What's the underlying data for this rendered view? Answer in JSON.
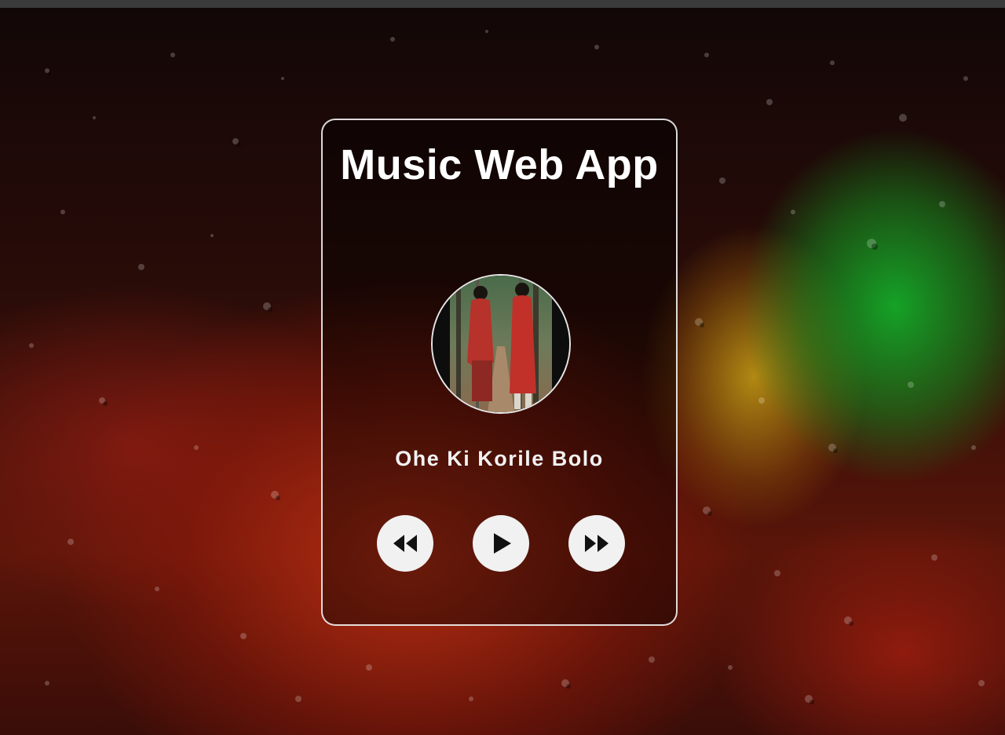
{
  "app": {
    "title": "Music Web App"
  },
  "player": {
    "song_title": "Ohe Ki Korile Bolo",
    "cover_art": "couple-walking-cover-art",
    "controls": [
      {
        "name": "prev-button",
        "icon": "rewind-icon"
      },
      {
        "name": "play-button",
        "icon": "play-icon"
      },
      {
        "name": "next-button",
        "icon": "fast-forward-icon"
      }
    ]
  },
  "colors": {
    "card_border": "#ffffff",
    "button_bg": "#f1f1f1",
    "icon_color": "#111111",
    "text": "#ffffff"
  }
}
